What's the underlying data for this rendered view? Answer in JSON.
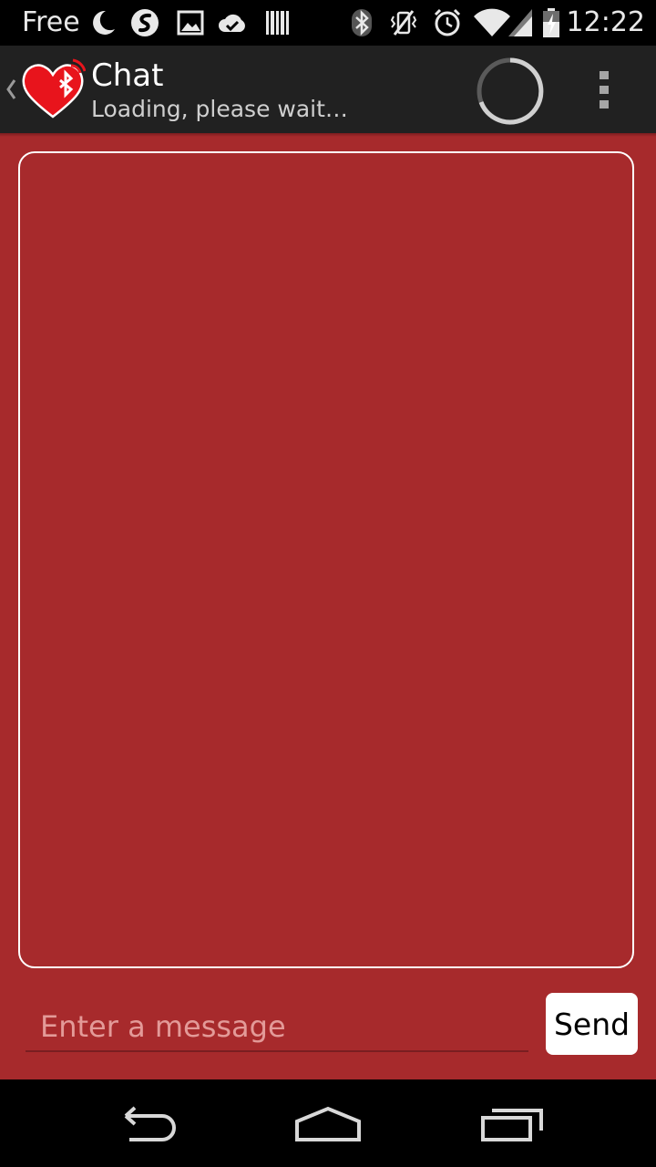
{
  "status_bar": {
    "carrier": "Free",
    "time": "12:22",
    "icons": [
      "moon-icon",
      "swiftkey-icon",
      "image-icon",
      "cloud-check-icon",
      "barcode-icon",
      "bluetooth-icon",
      "vibrate-icon",
      "alarm-icon",
      "wifi-icon",
      "signal-icon",
      "battery-charging-icon"
    ]
  },
  "action_bar": {
    "title": "Chat",
    "subtitle": "Loading, please wait…",
    "logo": "heart-bluetooth-icon",
    "progress": "loading-spinner",
    "menu": "overflow-menu-icon"
  },
  "composer": {
    "placeholder": "Enter a message",
    "value": "",
    "send_label": "Send"
  },
  "nav_bar": {
    "buttons": [
      "back-icon",
      "home-icon",
      "recents-icon"
    ]
  },
  "colors": {
    "background": "#a72a2c",
    "action_bar": "#212121",
    "status_bar": "#000000",
    "send_button": "#ffffff"
  }
}
